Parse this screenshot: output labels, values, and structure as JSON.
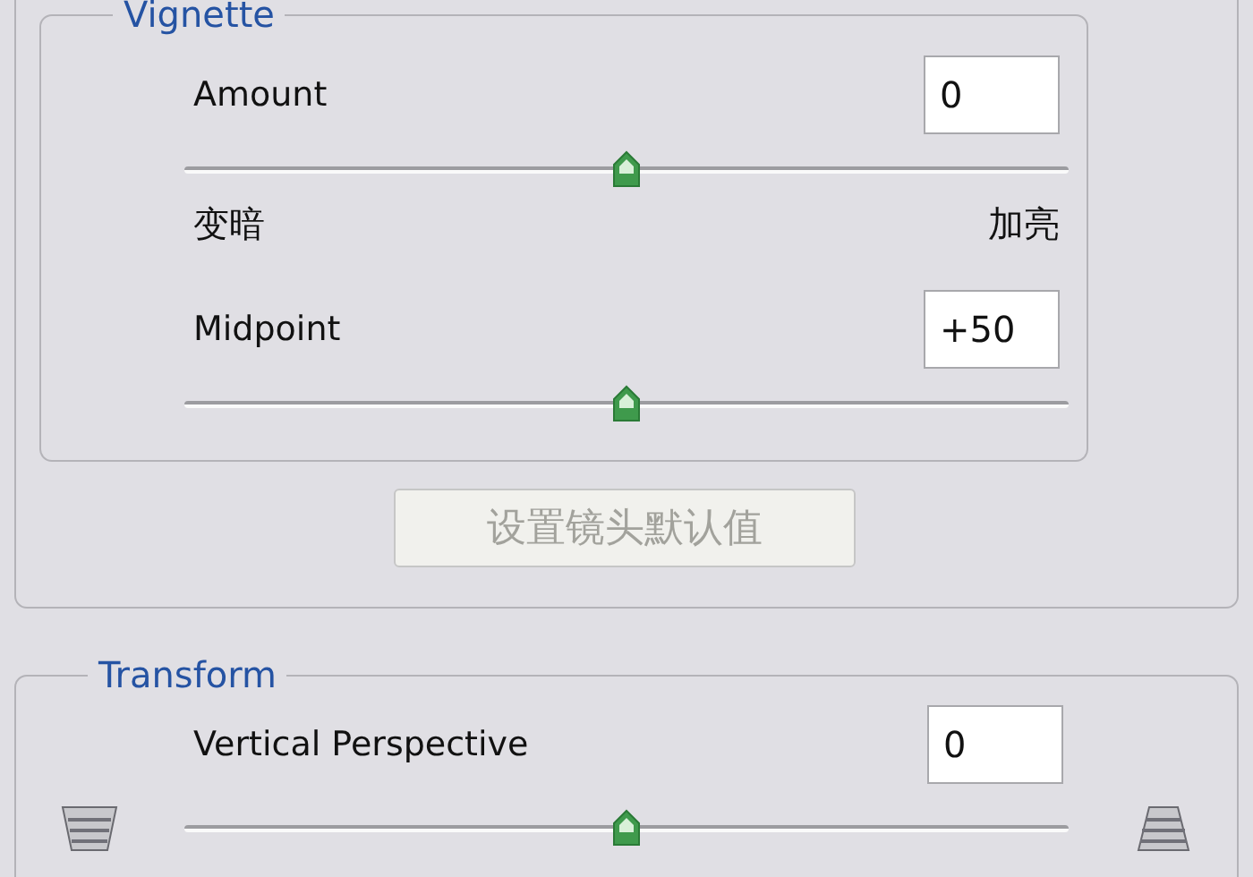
{
  "vignette_group": {
    "title": "Vignette",
    "controls": [
      {
        "label": "Amount",
        "value": "0",
        "level": 0.5,
        "min_label": "变暗",
        "max_label": "加亮"
      },
      {
        "label": "Midpoint",
        "value": "+50",
        "level": 0.5
      }
    ]
  },
  "lens_default_button": {
    "label": "设置镜头默认值",
    "disabled": true
  },
  "transform_group": {
    "title": "Transform",
    "controls": [
      {
        "label": "Vertical Perspective",
        "value": "0",
        "level": 0.5,
        "side_icons": true
      }
    ]
  }
}
